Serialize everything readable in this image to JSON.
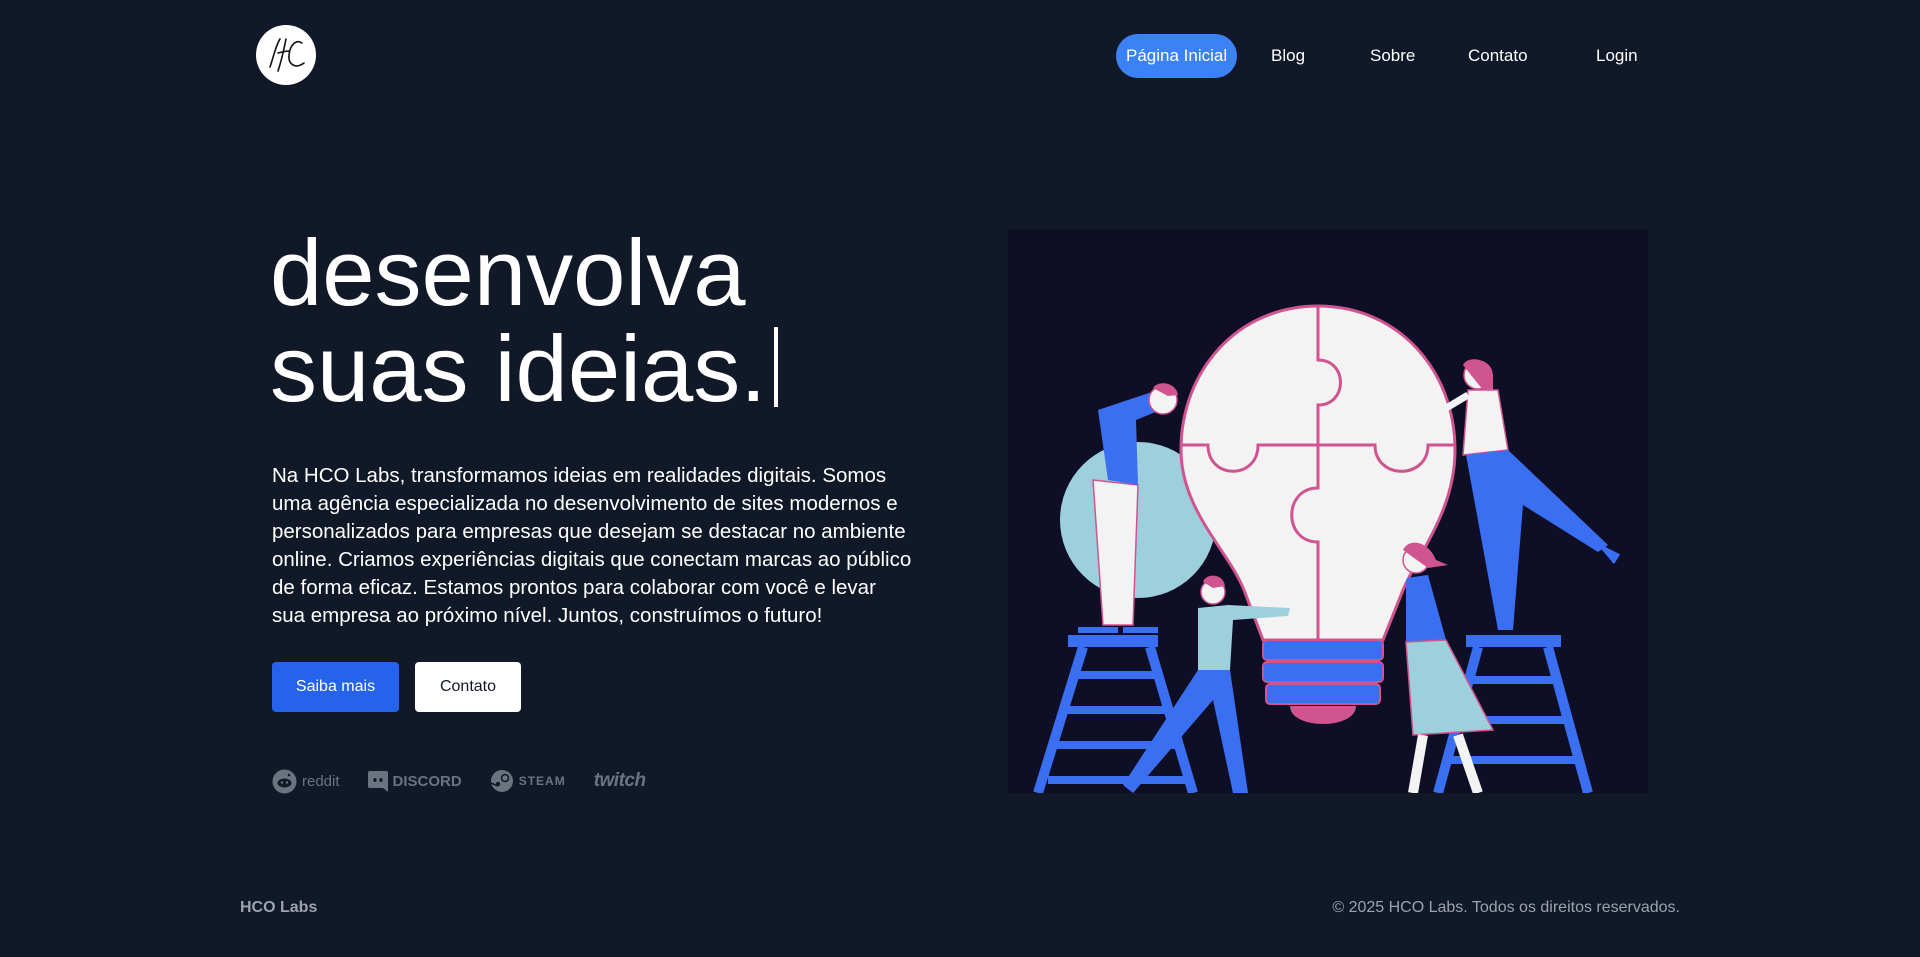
{
  "header": {
    "logo_alt": "HC",
    "nav": [
      {
        "label": "Página Inicial",
        "active": true
      },
      {
        "label": "Blog",
        "active": false
      },
      {
        "label": "Sobre",
        "active": false
      },
      {
        "label": "Contato",
        "active": false
      },
      {
        "label": "Login",
        "active": false
      }
    ]
  },
  "hero": {
    "title_line1": "desenvolva",
    "title_line2": "suas ideias.",
    "description": "Na HCO Labs, transformamos ideias em realidades digitais. Somos uma agência especializada no desenvolvimento de sites modernos e personalizados para empresas que desejam se destacar no ambiente online. Criamos experiências digitais que conectam marcas ao público de forma eficaz. Estamos prontos para colaborar com você e levar sua empresa ao próximo nível. Juntos, construímos o futuro!",
    "primary_button": "Saiba mais",
    "secondary_button": "Contato"
  },
  "brands": [
    {
      "name": "reddit",
      "icon": "reddit-icon"
    },
    {
      "name": "DISCORD",
      "icon": "discord-icon"
    },
    {
      "name": "STEAM",
      "icon": "steam-icon"
    },
    {
      "name": "twitch",
      "icon": "twitch-icon"
    }
  ],
  "footer": {
    "brand": "HCO Labs",
    "copyright": "© 2025 HCO Labs. Todos os direitos reservados."
  },
  "colors": {
    "background": "#111827",
    "accent": "#3b82f6",
    "primary_button": "#2563eb",
    "muted": "#9ca3af",
    "illustration_blue": "#3b6ff2",
    "illustration_pink": "#d0548f",
    "illustration_light": "#f3f3f3",
    "illustration_teal": "#9ecfdc"
  }
}
